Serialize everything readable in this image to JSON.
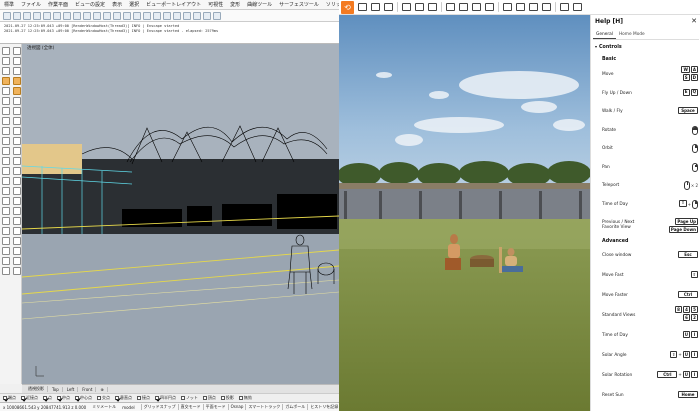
{
  "rhino": {
    "menu": [
      "標準",
      "ファイル",
      "作業平面",
      "ビューの設定",
      "表示",
      "選択",
      "ビューポートレイアウト",
      "可視性",
      "変形",
      "曲線ツール",
      "サーフェスツール",
      "ソリッド"
    ],
    "cmd_lines": [
      "2021-09-27 12:25:09.043 +09:00 [RenderWindowHost(Thread3)] INFO | Enscape started",
      "2021-09-27 12:25:09.043 +09:00 [RenderWindowHost(Thread3)] INFO | Enscape started - elapsed: 2579ms"
    ],
    "viewport_title": "透視図 (全体)",
    "viewport_tabs": [
      "透視投影",
      "Top",
      "Left",
      "Front",
      "⊕"
    ],
    "osnaps": [
      {
        "label": "端点",
        "on": true
      },
      {
        "label": "近接点",
        "on": true
      },
      {
        "label": "点",
        "on": true
      },
      {
        "label": "中点",
        "on": true
      },
      {
        "label": "中心点",
        "on": true
      },
      {
        "label": "交点",
        "on": false
      },
      {
        "label": "垂直点",
        "on": true
      },
      {
        "label": "接点",
        "on": false
      },
      {
        "label": "四半円点",
        "on": true
      },
      {
        "label": "ノット",
        "on": false
      },
      {
        "label": "頂点",
        "on": false
      },
      {
        "label": "投影",
        "on": false
      },
      {
        "label": "無効",
        "on": false
      }
    ],
    "status": {
      "coords": "x 10008661.543   y 20847741.913   z 0.000",
      "unit": "ミリメートル",
      "layer": "model",
      "buttons": [
        "グリッドスナップ",
        "直交モード",
        "平面モード",
        "Osnap",
        "スマートトラック",
        "ガムボール",
        "ヒストリを記録"
      ]
    }
  },
  "enscape": {
    "help": {
      "title": "Help [H]",
      "close_icon": "close-icon",
      "tabs": [
        "General",
        "Home Mode"
      ],
      "active_tab": 0,
      "controls_heading": "Controls",
      "basic_heading": "Basic",
      "advanced_heading": "Advanced",
      "basic": [
        {
          "label": "Move",
          "keys": [
            "W",
            "A",
            "S",
            "D"
          ]
        },
        {
          "label": "Fly Up / Down",
          "keys": [
            "E",
            "Q"
          ]
        },
        {
          "label": "Walk / Fly",
          "keys": [
            "Space"
          ]
        },
        {
          "label": "Rotate",
          "keys": [
            "mouse-left-icon"
          ]
        },
        {
          "label": "Orbit",
          "keys": [
            "mouse-right-icon"
          ]
        },
        {
          "label": "Pan",
          "keys": [
            "mouse-middle-icon"
          ]
        },
        {
          "label": "Teleport",
          "keys": [
            "mouse-middle-icon",
            "× 2"
          ]
        },
        {
          "label": "Time of Day",
          "keys": [
            "⇧",
            "+",
            "mouse-right-icon"
          ]
        },
        {
          "label": "Previous / Next Favorite View",
          "keys": [
            "Page Up",
            "Page Down"
          ]
        }
      ],
      "advanced": [
        {
          "label": "Close window",
          "keys": [
            "Esc"
          ]
        },
        {
          "label": "Move Fast",
          "keys": [
            "⇧"
          ]
        },
        {
          "label": "Move Faster",
          "keys": [
            "Ctrl"
          ]
        },
        {
          "label": "Standard Views",
          "keys": [
            "8",
            "4",
            "5",
            "6",
            "2"
          ]
        },
        {
          "label": "Time of Day",
          "keys": [
            "U",
            "I"
          ]
        },
        {
          "label": "Solar Angle",
          "keys": [
            "⇧",
            "+",
            "U",
            "I"
          ]
        },
        {
          "label": "Solar Rotation",
          "keys": [
            "Ctrl",
            "+",
            "U",
            "I"
          ]
        },
        {
          "label": "Reset Sun",
          "keys": [
            "Home"
          ]
        }
      ]
    }
  }
}
